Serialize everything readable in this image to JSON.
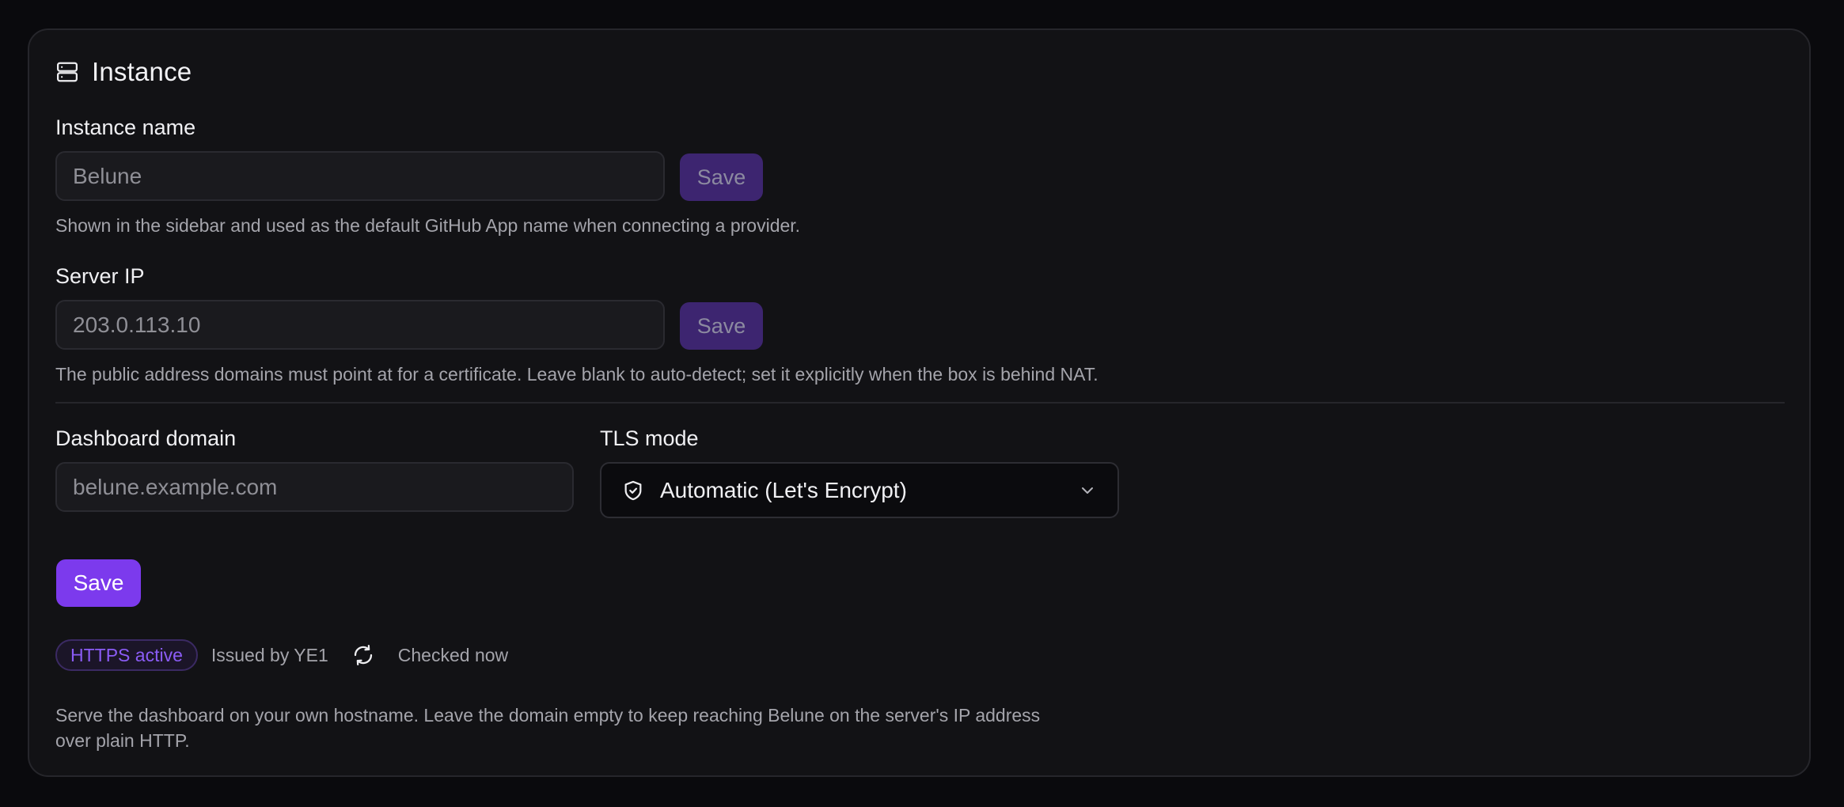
{
  "card": {
    "title": "Instance",
    "icon": "server-icon"
  },
  "instance_name": {
    "label": "Instance name",
    "value": "Belune",
    "save_label": "Save",
    "help": "Shown in the sidebar and used as the default GitHub App name when connecting a provider."
  },
  "server_ip": {
    "label": "Server IP",
    "value": "203.0.113.10",
    "save_label": "Save",
    "help": "The public address domains must point at for a certificate. Leave blank to auto-detect; set it explicitly when the box is behind NAT."
  },
  "dashboard_domain": {
    "label": "Dashboard domain",
    "placeholder": "belune.example.com"
  },
  "tls_mode": {
    "label": "TLS mode",
    "selected": "Automatic (Let's Encrypt)",
    "icon": "shield-check-icon",
    "chevron": "chevron-down-icon"
  },
  "save_button": {
    "label": "Save"
  },
  "status": {
    "badge": "HTTPS active",
    "issuer": "Issued by YE1",
    "refresh_icon": "refresh-icon",
    "checked": "Checked now"
  },
  "footer_help": {
    "line1": "Serve the dashboard on your own hostname. Leave the domain empty to keep reaching Belune on the server's IP address",
    "line2": "over plain HTTP."
  },
  "colors": {
    "background": "#0a0a0d",
    "card": "#121215",
    "accent": "#7c3aed",
    "accent_disabled": "#3d2570",
    "badge_text": "#8b5cf6"
  }
}
